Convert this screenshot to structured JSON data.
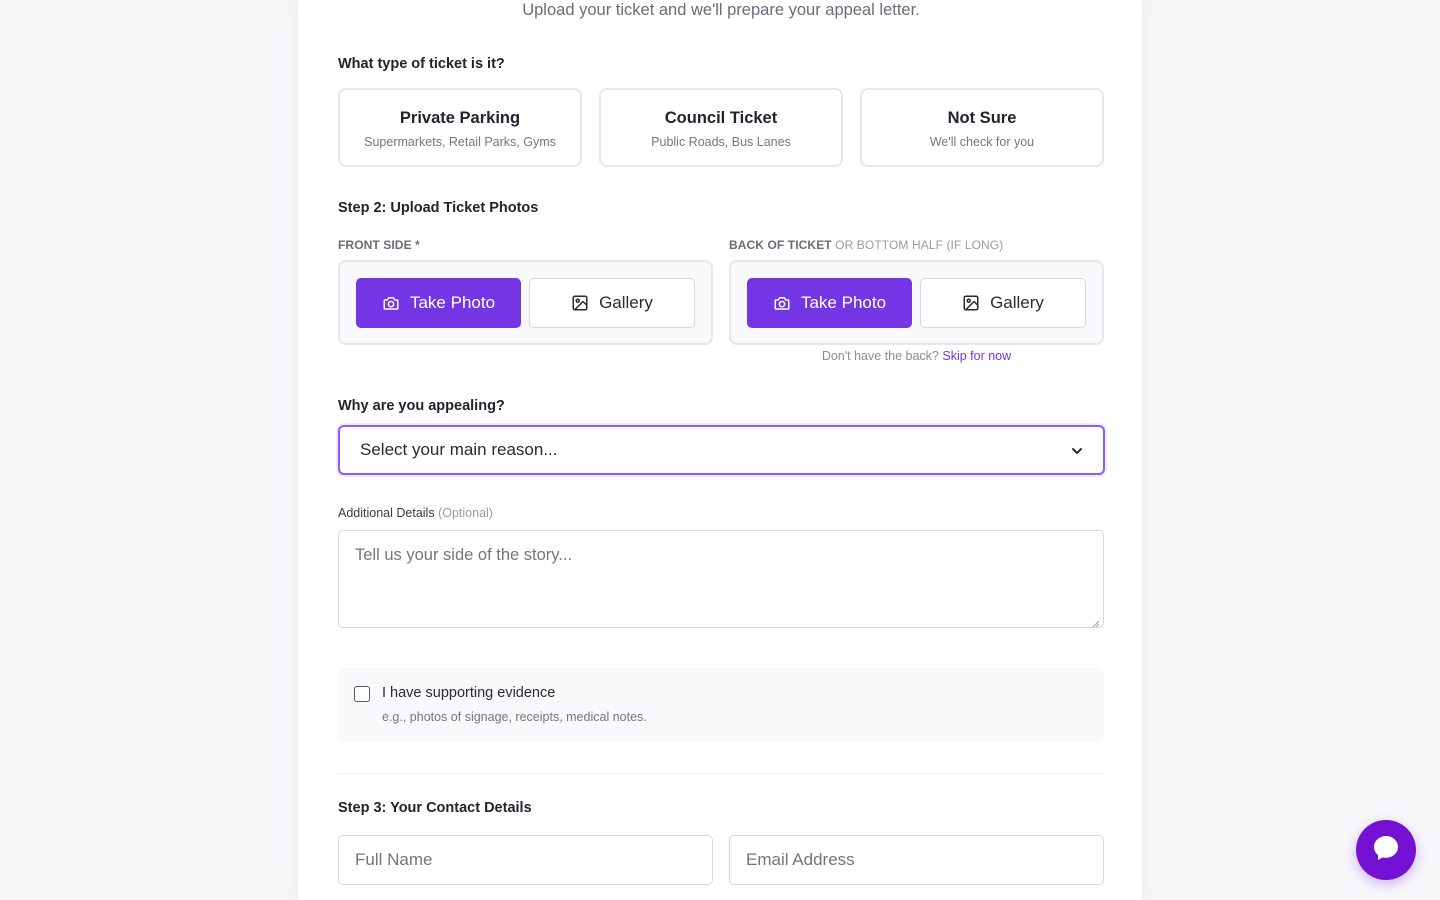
{
  "header": {
    "subtitle": "Upload your ticket and we'll prepare your appeal letter."
  },
  "ticket_type": {
    "question": "What type of ticket is it?",
    "options": [
      {
        "title": "Private Parking",
        "subtitle": "Supermarkets, Retail Parks, Gyms"
      },
      {
        "title": "Council Ticket",
        "subtitle": "Public Roads, Bus Lanes"
      },
      {
        "title": "Not Sure",
        "subtitle": "We'll check for you"
      }
    ]
  },
  "upload": {
    "step_label": "Step 2: Upload Ticket Photos",
    "front": {
      "label": "FRONT SIDE *",
      "take_photo": "Take Photo",
      "gallery": "Gallery"
    },
    "back": {
      "label_main": "BACK OF TICKET",
      "label_light": "OR BOTTOM HALF (IF LONG)",
      "take_photo": "Take Photo",
      "gallery": "Gallery"
    },
    "skip_prefix": "Don't have the back?",
    "skip_link": "Skip for now"
  },
  "reason": {
    "question": "Why are you appealing?",
    "selected": "Select your main reason..."
  },
  "details": {
    "label": "Additional Details",
    "optional": "(Optional)",
    "placeholder": "Tell us your side of the story..."
  },
  "evidence": {
    "title": "I have supporting evidence",
    "subtitle": "e.g., photos of signage, receipts, medical notes.",
    "checked": false
  },
  "contact": {
    "step_label": "Step 3: Your Contact Details",
    "name_placeholder": "Full Name",
    "email_placeholder": "Email Address"
  },
  "icons": {
    "camera": "camera-icon",
    "image": "image-icon",
    "chat": "chat-icon",
    "chevron": "chevron-down-icon"
  },
  "colors": {
    "primary": "#7436e4",
    "chat": "#7411d3",
    "focus": "#8b5cf6"
  }
}
